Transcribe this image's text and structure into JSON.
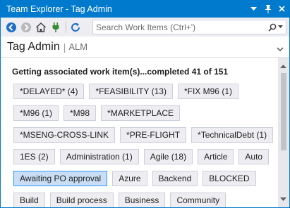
{
  "window": {
    "title": "Team Explorer - Tag Admin",
    "buttons": [
      "dropdown-icon",
      "pin-icon",
      "close-icon"
    ]
  },
  "toolbar": {
    "tools": [
      "back-icon",
      "forward-icon",
      "home-icon",
      "plug-icon",
      "refresh-icon"
    ],
    "search_placeholder": "Search Work Items (Ctrl+')",
    "search_icon": "search-icon"
  },
  "header": {
    "title": "Tag Admin",
    "separator": "|",
    "project": "ALM"
  },
  "status_text": "Getting associated work item(s)...completed 41 of 151",
  "tags": [
    {
      "label": "*DELAYED* (4)",
      "selected": false
    },
    {
      "label": "*FEASIBILITY (13)",
      "selected": false
    },
    {
      "label": "*FIX M96 (1)",
      "selected": false
    },
    {
      "label": "*M96 (1)",
      "selected": false
    },
    {
      "label": "*M98",
      "selected": false
    },
    {
      "label": "*MARKETPLACE",
      "selected": false
    },
    {
      "label": "*MSENG-CROSS-LINK",
      "selected": false
    },
    {
      "label": "*PRE-FLIGHT",
      "selected": false
    },
    {
      "label": "*TechnicalDebt (1)",
      "selected": false
    },
    {
      "label": "1ES (2)",
      "selected": false
    },
    {
      "label": "Administration (1)",
      "selected": false
    },
    {
      "label": "Agile (18)",
      "selected": false
    },
    {
      "label": "Article",
      "selected": false
    },
    {
      "label": "Auto",
      "selected": false
    },
    {
      "label": "Awaiting PO approval",
      "selected": true
    },
    {
      "label": "Azure",
      "selected": false
    },
    {
      "label": "Backend",
      "selected": false
    },
    {
      "label": "BLOCKED",
      "selected": false
    },
    {
      "label": "Build",
      "selected": false
    },
    {
      "label": "Build process",
      "selected": false
    },
    {
      "label": "Business",
      "selected": false
    },
    {
      "label": "Community",
      "selected": false
    }
  ],
  "colors": {
    "accent": "#007acc",
    "tag_bg": "#eeeef2",
    "tag_selected_bg": "#c9def5",
    "tag_selected_border": "#3399ff"
  }
}
